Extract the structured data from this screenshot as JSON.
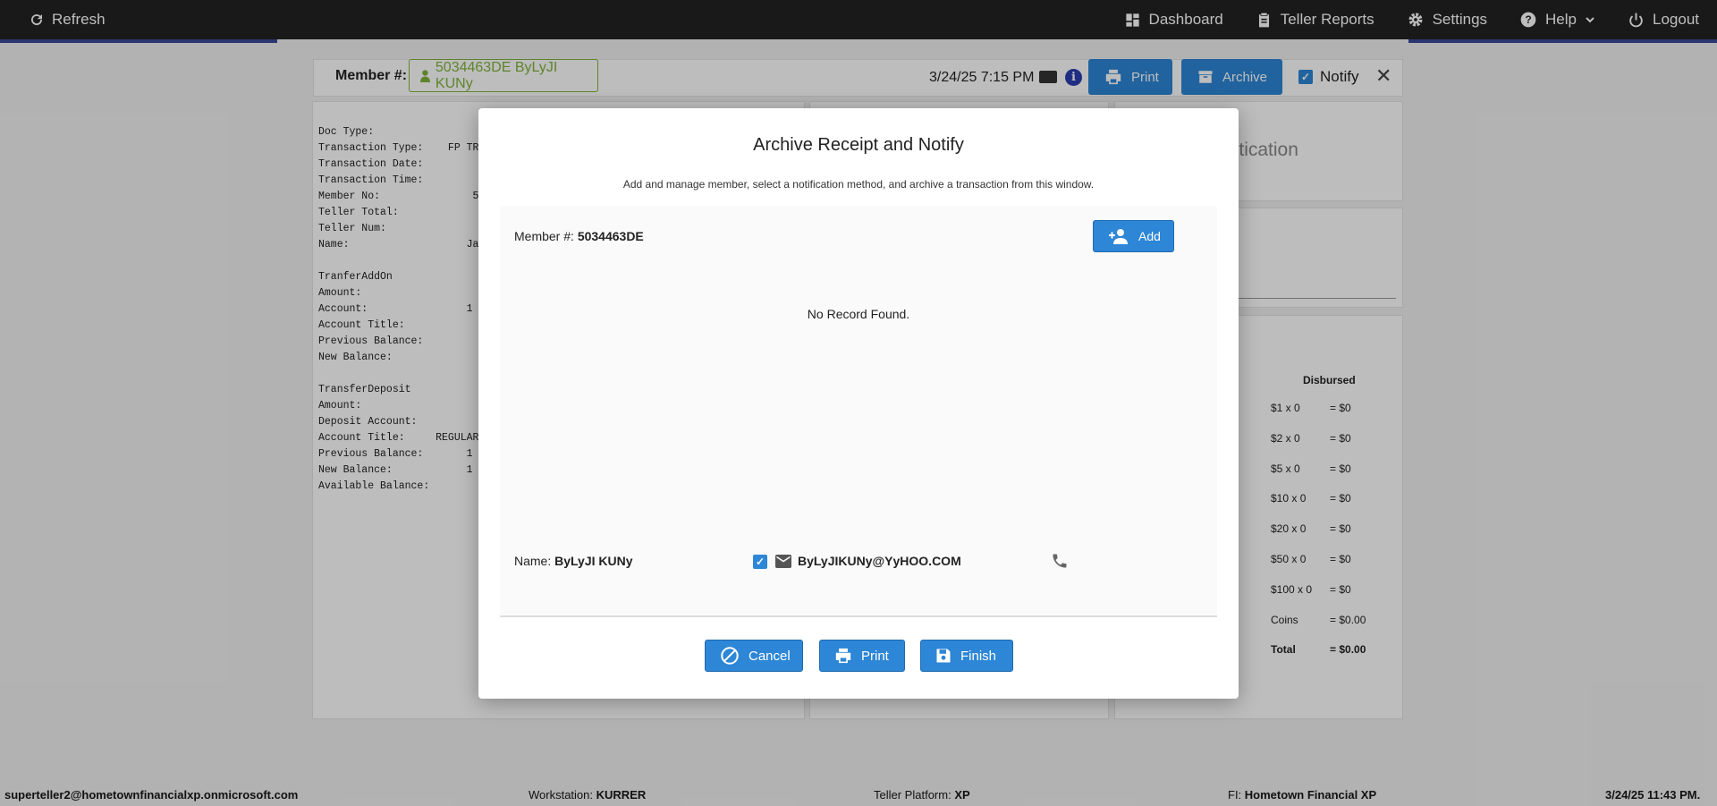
{
  "topbar": {
    "refresh_label": "Refresh",
    "nav": {
      "dashboard": "Dashboard",
      "teller_reports": "Teller Reports",
      "settings": "Settings",
      "help": "Help",
      "logout": "Logout"
    }
  },
  "header": {
    "member_label": "Member #:",
    "member_badge": "5034463DE ByLyJI KUNy",
    "datetime": "3/24/25 7:15 PM",
    "info_glyph": "i",
    "print_label": "Print",
    "archive_label": "Archive",
    "notify_label": "Notify",
    "notify_checked": true
  },
  "receipt": {
    "lines": [
      "Doc Type:",
      "Transaction Type:    FP TRA",
      "Transaction Date:",
      "Transaction Time:",
      "Member No:               5",
      "Teller Total:",
      "Teller Num:",
      "Name:                   Ja",
      "",
      "TranferAddOn",
      "Amount:",
      "Account:                1",
      "Account Title:",
      "Previous Balance:",
      "New Balance:",
      "",
      "TransferDeposit",
      "Amount:",
      "Deposit Account:",
      "Account Title:     REGULAR",
      "Previous Balance:       1",
      "New Balance:            1",
      "Available Balance:"
    ]
  },
  "side": {
    "auth_text": "entication",
    "cash_header": "Disbursed",
    "cash_rows": [
      {
        "denom": "$1 x 0",
        "amount": "= $0"
      },
      {
        "denom": "$2 x 0",
        "amount": "= $0"
      },
      {
        "denom": "$5 x 0",
        "amount": "= $0"
      },
      {
        "denom": "$10 x 0",
        "amount": "= $0"
      },
      {
        "denom": "$20 x 0",
        "amount": "= $0"
      },
      {
        "denom": "$50 x 0",
        "amount": "= $0"
      },
      {
        "denom": "$100 x 0",
        "amount": "= $0"
      },
      {
        "denom": "Coins",
        "amount": "= $0.00"
      },
      {
        "denom": "Total",
        "amount": "= $0.00"
      }
    ]
  },
  "modal": {
    "title": "Archive Receipt and Notify",
    "subtitle": "Add and manage member, select a notification method, and archive a transaction from this window.",
    "member_label": "Member #:",
    "member_value": "5034463DE",
    "add_label": "Add",
    "no_record": "No Record Found.",
    "name_label": "Name:",
    "name_value": "ByLyJI KUNy",
    "email_checked": true,
    "email": "ByLyJIKUNy@YyHOO.COM",
    "cancel_label": "Cancel",
    "print_label": "Print",
    "finish_label": "Finish"
  },
  "footer": {
    "user": "superteller2@hometownfinancialxp.onmicrosoft.com",
    "workstation_label": "Workstation:",
    "workstation": "KURRER",
    "platform_label": "Teller Platform:",
    "platform": "XP",
    "fi_label": "FI:",
    "fi": "Hometown Financial XP",
    "datetime": "3/24/25 11:43 PM."
  },
  "colors": {
    "accent": "#2d86d6",
    "topbar": "#232323",
    "member_green": "#7fb23a",
    "strip": "#3a4a9a"
  }
}
